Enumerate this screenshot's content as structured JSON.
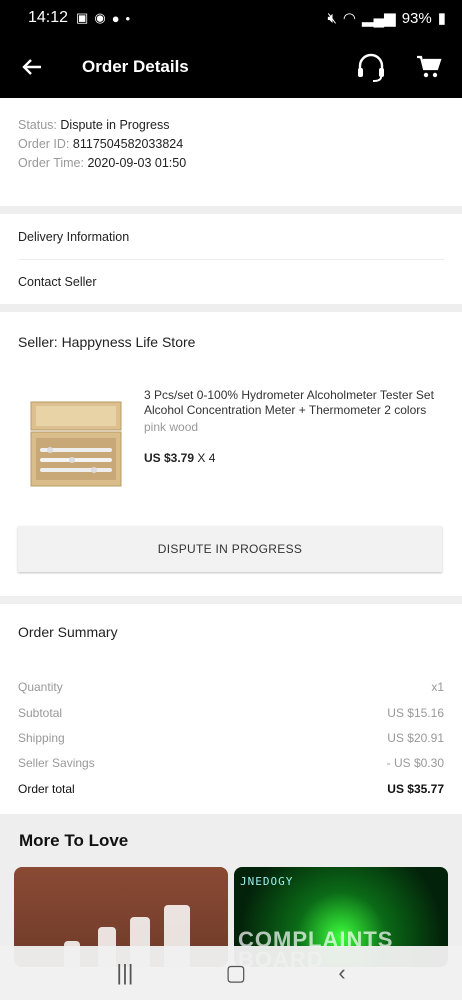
{
  "status_bar": {
    "time": "14:12",
    "battery": "93%"
  },
  "app_bar": {
    "title": "Order Details"
  },
  "order": {
    "status_label": "Status:",
    "status_value": "Dispute in Progress",
    "id_label": "Order ID:",
    "id_value": "8117504582033824",
    "time_label": "Order Time:",
    "time_value": "2020-09-03 01:50"
  },
  "links": {
    "delivery": "Delivery Information",
    "contact": "Contact Seller"
  },
  "seller": {
    "title": "Seller: Happyness Life Store"
  },
  "product": {
    "name": "3 Pcs/set 0-100% Hydrometer Alcoholmeter Tester Set Alcohol Concentration Meter + Thermometer 2 colors",
    "variant": "pink wood",
    "price": "US $3.79",
    "quantity": "X 4"
  },
  "dispute_button": "DISPUTE IN PROGRESS",
  "summary": {
    "title": "Order Summary",
    "rows": [
      {
        "label": "Quantity",
        "value": "x1"
      },
      {
        "label": "Subtotal",
        "value": "US $15.16"
      },
      {
        "label": "Shipping",
        "value": "US $20.91"
      },
      {
        "label": "Seller Savings",
        "value": "- US $0.30"
      },
      {
        "label": "Order total",
        "value": "US $35.77"
      }
    ]
  },
  "more": {
    "title": "More To Love",
    "tile2_text": "JNEDOGY"
  },
  "watermark": "COMPLAINTS BOARD",
  "colors": {
    "app_bar_bg": "#000000",
    "text_muted": "#999999"
  }
}
